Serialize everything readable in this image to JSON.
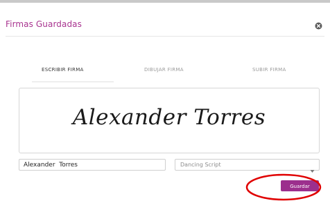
{
  "dialog": {
    "title": "Firmas Guardadas"
  },
  "tabs": [
    {
      "label": "ESCRIBIR FIRMA",
      "active": true
    },
    {
      "label": "DIBUJAR FIRMA",
      "active": false
    },
    {
      "label": "SUBIR FIRMA",
      "active": false
    }
  ],
  "signature": {
    "preview_text": "Alexander Torres",
    "name_value": "Alexander  Torres",
    "font_selected": "Dancing Script"
  },
  "actions": {
    "save_label": "Guardar"
  },
  "colors": {
    "accent": "#9c2f8d",
    "title": "#a8338f",
    "annotation": "#e00000"
  },
  "icons": {
    "close": "close-circle-icon",
    "dropdown": "chevron-down-icon"
  }
}
